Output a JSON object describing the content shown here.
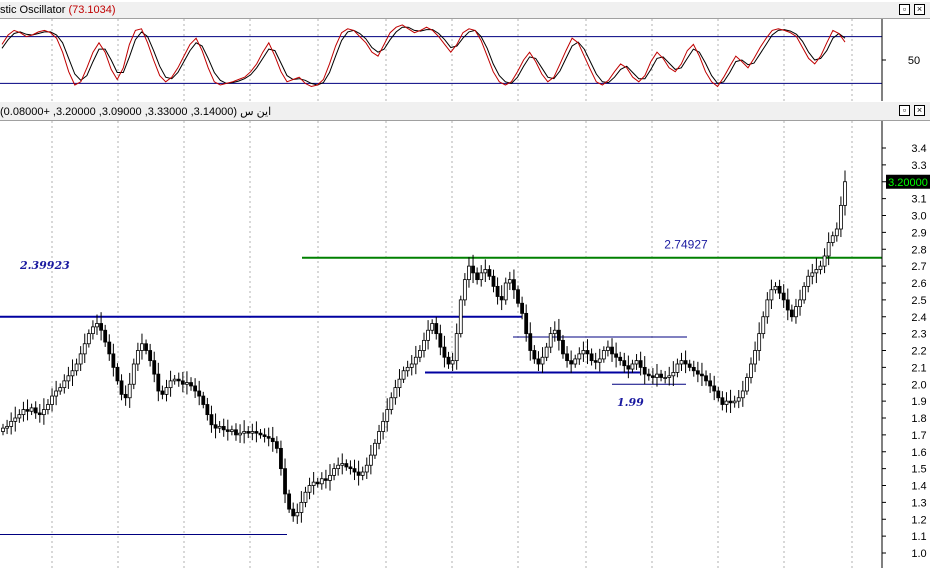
{
  "oscillator_pane": {
    "title_prefix": "stic Oscillator",
    "title_value": "(73.1034)",
    "level_label": "50"
  },
  "price_pane": {
    "title_symbol": "این س",
    "title_ohlc": "(3.14000, 3.33000, 3.09000, 3.20000, +0.08000)",
    "last_price_tag": "3.20000",
    "ann_resistance": "2.74927",
    "ann_left": "2.39923",
    "ann_support": "1.99"
  },
  "colors": {
    "candle": "#000000",
    "stoch_k": "#c00000",
    "stoch_d": "#000000",
    "level_line": "#000080",
    "green_line": "#008000",
    "blue_line": "#0000a0",
    "annotation": "#1a1aa0",
    "price_tag_bg": "#000000",
    "price_tag_fg": "#00ff00"
  },
  "chart_data": [
    {
      "type": "line",
      "name": "stochastic oscillator",
      "y_ticks": [
        50
      ],
      "levels": [
        20,
        80
      ],
      "ylim": [
        0,
        100
      ],
      "k": [
        70,
        82,
        88,
        85,
        80,
        82,
        86,
        88,
        85,
        78,
        60,
        35,
        18,
        22,
        40,
        60,
        72,
        60,
        38,
        25,
        40,
        70,
        88,
        90,
        72,
        50,
        30,
        22,
        28,
        40,
        55,
        70,
        78,
        62,
        40,
        22,
        18,
        20,
        22,
        25,
        28,
        35,
        45,
        60,
        72,
        55,
        35,
        22,
        25,
        28,
        20,
        16,
        18,
        25,
        45,
        68,
        85,
        90,
        88,
        80,
        72,
        60,
        55,
        70,
        85,
        92,
        95,
        90,
        85,
        88,
        92,
        88,
        80,
        70,
        60,
        70,
        85,
        90,
        88,
        75,
        55,
        35,
        22,
        18,
        22,
        35,
        50,
        60,
        48,
        32,
        22,
        28,
        45,
        62,
        78,
        72,
        55,
        38,
        22,
        18,
        24,
        35,
        45,
        40,
        28,
        22,
        30,
        48,
        60,
        52,
        40,
        35,
        45,
        62,
        70,
        55,
        35,
        22,
        16,
        28,
        42,
        55,
        48,
        40,
        52,
        66,
        78,
        88,
        90,
        88,
        85,
        80,
        66,
        52,
        45,
        55,
        72,
        88,
        84,
        73
      ],
      "d": [
        65,
        76,
        84,
        86,
        83,
        82,
        84,
        86,
        86,
        82,
        72,
        52,
        32,
        24,
        30,
        48,
        64,
        64,
        50,
        34,
        34,
        54,
        76,
        86,
        80,
        62,
        42,
        28,
        26,
        34,
        48,
        62,
        72,
        68,
        52,
        34,
        24,
        20,
        21,
        23,
        26,
        31,
        40,
        52,
        64,
        62,
        46,
        30,
        25,
        26,
        24,
        20,
        18,
        21,
        34,
        55,
        75,
        86,
        88,
        84,
        77,
        66,
        60,
        64,
        76,
        86,
        92,
        92,
        88,
        87,
        89,
        89,
        84,
        76,
        66,
        68,
        78,
        86,
        88,
        80,
        65,
        45,
        30,
        22,
        20,
        28,
        42,
        54,
        52,
        40,
        28,
        26,
        36,
        52,
        68,
        73,
        64,
        48,
        32,
        22,
        21,
        28,
        38,
        42,
        34,
        26,
        26,
        38,
        52,
        54,
        46,
        38,
        40,
        52,
        64,
        60,
        46,
        30,
        20,
        22,
        34,
        48,
        50,
        44,
        46,
        58,
        70,
        82,
        88,
        89,
        87,
        83,
        74,
        60,
        50,
        52,
        62,
        78,
        84,
        78
      ]
    },
    {
      "type": "candlestick",
      "name": "price",
      "ylim": [
        0.95,
        3.5
      ],
      "y_ticks": [
        1.0,
        1.1,
        1.2,
        1.3,
        1.4,
        1.5,
        1.6,
        1.7,
        1.8,
        1.9,
        2.0,
        2.1,
        2.2,
        2.3,
        2.4,
        2.5,
        2.6,
        2.7,
        2.8,
        2.9,
        3.0,
        3.1,
        3.2,
        3.3,
        3.4
      ],
      "close": [
        1.74,
        1.75,
        1.78,
        1.8,
        1.82,
        1.85,
        1.84,
        1.86,
        1.83,
        1.82,
        1.85,
        1.88,
        1.93,
        1.96,
        1.98,
        2.02,
        2.05,
        2.08,
        2.12,
        2.18,
        2.24,
        2.3,
        2.34,
        2.36,
        2.32,
        2.25,
        2.18,
        2.1,
        2.02,
        1.94,
        1.92,
        2.0,
        2.12,
        2.2,
        2.24,
        2.2,
        2.14,
        2.06,
        1.96,
        1.94,
        1.98,
        2.02,
        2.03,
        2.02,
        2.0,
        2.01,
        1.99,
        1.96,
        1.93,
        1.88,
        1.82,
        1.76,
        1.74,
        1.75,
        1.73,
        1.72,
        1.73,
        1.7,
        1.71,
        1.72,
        1.71,
        1.72,
        1.71,
        1.7,
        1.69,
        1.68,
        1.66,
        1.62,
        1.5,
        1.35,
        1.26,
        1.22,
        1.24,
        1.3,
        1.36,
        1.4,
        1.42,
        1.41,
        1.44,
        1.43,
        1.46,
        1.5,
        1.52,
        1.53,
        1.51,
        1.5,
        1.48,
        1.46,
        1.48,
        1.52,
        1.58,
        1.65,
        1.72,
        1.78,
        1.85,
        1.92,
        1.98,
        2.03,
        2.08,
        2.1,
        2.12,
        2.16,
        2.2,
        2.26,
        2.32,
        2.36,
        2.3,
        2.22,
        2.16,
        2.12,
        2.14,
        2.3,
        2.5,
        2.62,
        2.7,
        2.66,
        2.62,
        2.66,
        2.68,
        2.64,
        2.58,
        2.52,
        2.5,
        2.6,
        2.62,
        2.56,
        2.48,
        2.42,
        2.3,
        2.2,
        2.15,
        2.12,
        2.16,
        2.22,
        2.3,
        2.32,
        2.26,
        2.18,
        2.14,
        2.12,
        2.15,
        2.18,
        2.2,
        2.18,
        2.14,
        2.13,
        2.15,
        2.2,
        2.22,
        2.18,
        2.16,
        2.14,
        2.11,
        2.09,
        2.12,
        2.14,
        2.1,
        2.06,
        2.05,
        2.04,
        2.06,
        2.04,
        2.04,
        2.05,
        2.07,
        2.12,
        2.14,
        2.12,
        2.1,
        2.08,
        2.06,
        2.05,
        2.02,
        1.99,
        1.96,
        1.92,
        1.88,
        1.9,
        1.89,
        1.9,
        1.92,
        1.96,
        2.04,
        2.12,
        2.2,
        2.3,
        2.4,
        2.5,
        2.56,
        2.58,
        2.54,
        2.5,
        2.44,
        2.4,
        2.46,
        2.5,
        2.58,
        2.64,
        2.66,
        2.68,
        2.7,
        2.76,
        2.84,
        2.88,
        2.92,
        3.06,
        3.2
      ]
    }
  ]
}
